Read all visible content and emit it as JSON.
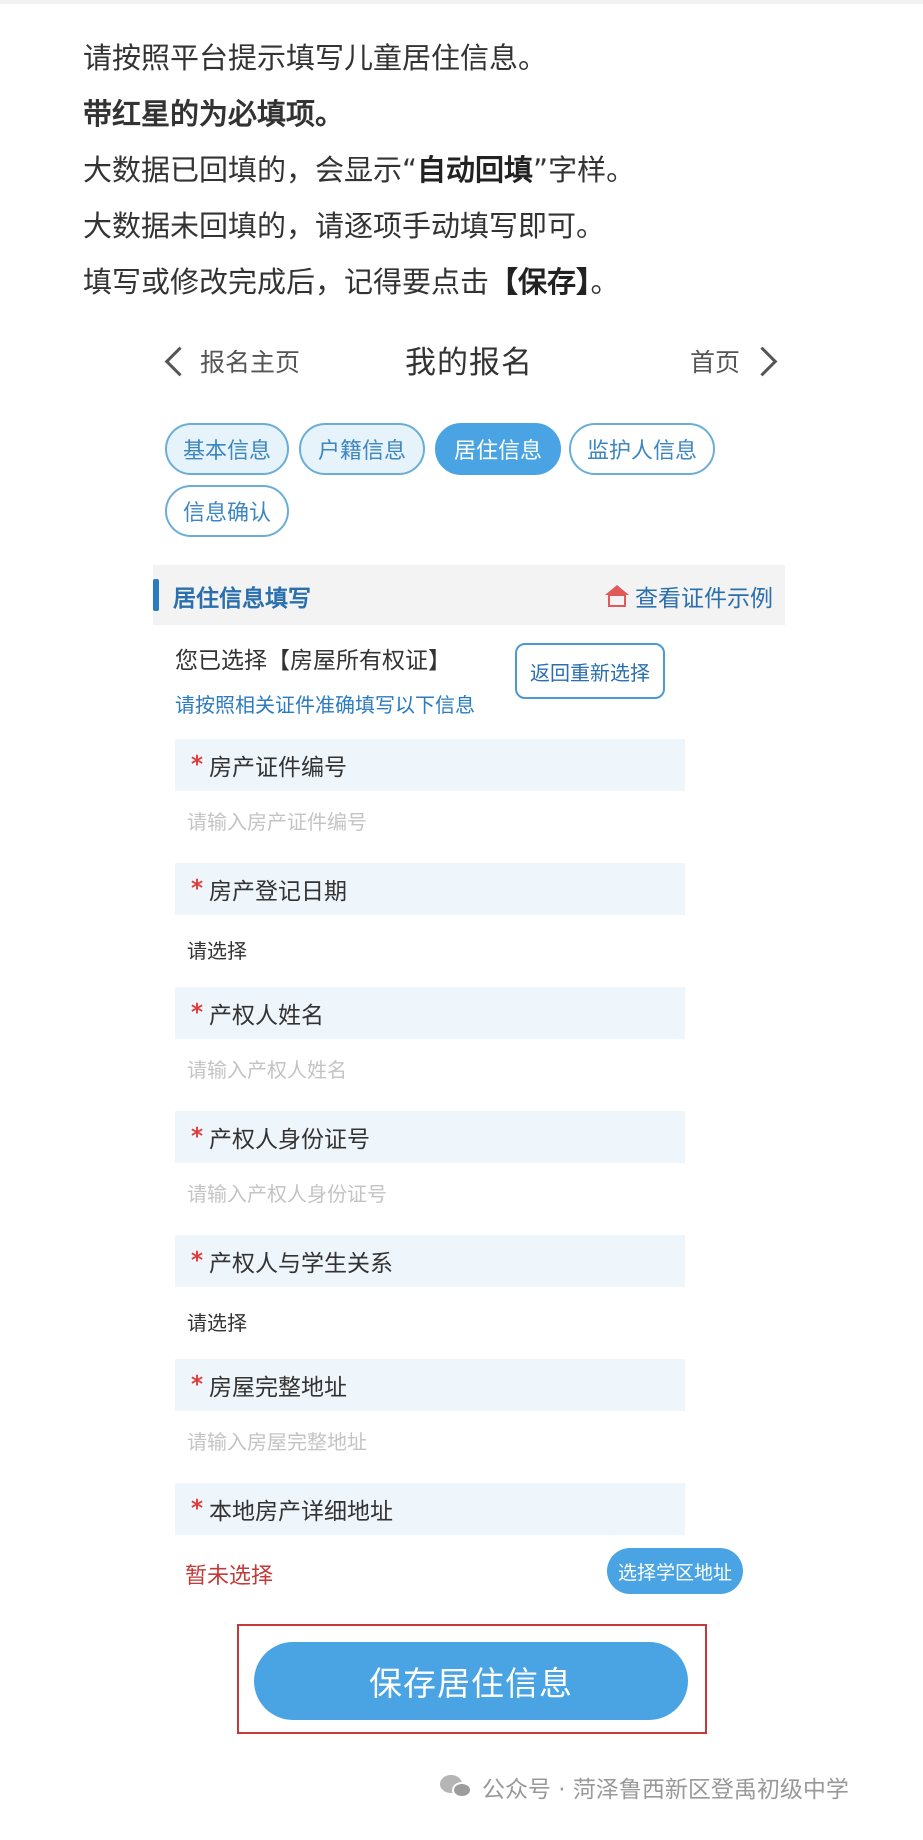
{
  "intro": {
    "line1": "请按照平台提示填写儿童居住信息。",
    "line2": "带红星的为必填项。",
    "line3_a": "大数据已回填的，会显示“",
    "line3_b": "自动回填",
    "line3_c": "”字样。",
    "line4": "大数据未回填的，请逐项手动填写即可。",
    "line5_a": "填写或修改完成后，记得要点击",
    "line5_b": "【保存】",
    "line5_c": "。"
  },
  "nav": {
    "back_label": "报名主页",
    "title": "我的报名",
    "home_label": "首页"
  },
  "tabs": [
    "基本信息",
    "户籍信息",
    "居住信息",
    "监护人信息",
    "信息确认"
  ],
  "active_tab": "居住信息",
  "section": {
    "title": "居住信息填写",
    "example_link": "查看证件示例"
  },
  "selection": {
    "chosen_text": "您已选择【房屋所有权证】",
    "hint": "请按照相关证件准确填写以下信息",
    "reselect_button": "返回重新选择"
  },
  "required_mark": "*",
  "fields": [
    {
      "label": "房产证件编号",
      "placeholder": "请输入房产证件编号"
    },
    {
      "label": "房产登记日期",
      "value": "请选择"
    },
    {
      "label": "产权人姓名",
      "placeholder": "请输入产权人姓名"
    },
    {
      "label": "产权人身份证号",
      "placeholder": "请输入产权人身份证号"
    },
    {
      "label": "产权人与学生关系",
      "value": "请选择"
    },
    {
      "label": "房屋完整地址",
      "placeholder": "请输入房屋完整地址"
    },
    {
      "label": "本地房产详细地址",
      "value": "暂未选择"
    }
  ],
  "school_button": "选择学区地址",
  "save_button": "保存居住信息",
  "footer": "公众号 · 菏泽鲁西新区登禹初级中学",
  "colors": {
    "accent": "#4aa4e3",
    "required": "#e23b3b",
    "highlight_frame": "#c43a3a"
  }
}
